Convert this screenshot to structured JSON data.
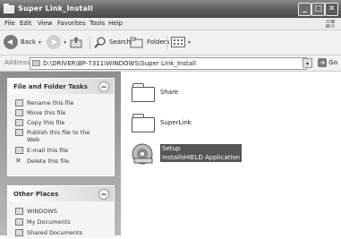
{
  "window": {
    "title": "Super Link_Install",
    "controls": [
      "_",
      "□",
      "✕"
    ]
  },
  "menu": [
    "File",
    "Edit",
    "View",
    "Favorites",
    "Tools",
    "Help"
  ],
  "toolbar": {
    "back_label": "Back",
    "search_label": "Search",
    "folders_label": "Folders"
  },
  "address": {
    "label": "Address",
    "path": "D:\\DRIVER\\BP-7311\\WINDOWS\\Super Link_Install",
    "go_label": "Go"
  },
  "left_pane": {
    "file_tasks": {
      "title": "File and Folder Tasks",
      "items": [
        "Rename this file",
        "Move this file",
        "Copy this file",
        "Publish this file to the Web",
        "E-mail this file",
        "Delete this file"
      ]
    },
    "other_places": {
      "title": "Other Places",
      "items": [
        "WINDOWS",
        "My Documents",
        "Shared Documents"
      ]
    }
  },
  "files": [
    {
      "name": "Share",
      "type": "folder"
    },
    {
      "name": "SuperLink",
      "type": "folder"
    },
    {
      "name": "Setup",
      "subtitle": "InstallsHIELD Application",
      "type": "installer"
    }
  ]
}
